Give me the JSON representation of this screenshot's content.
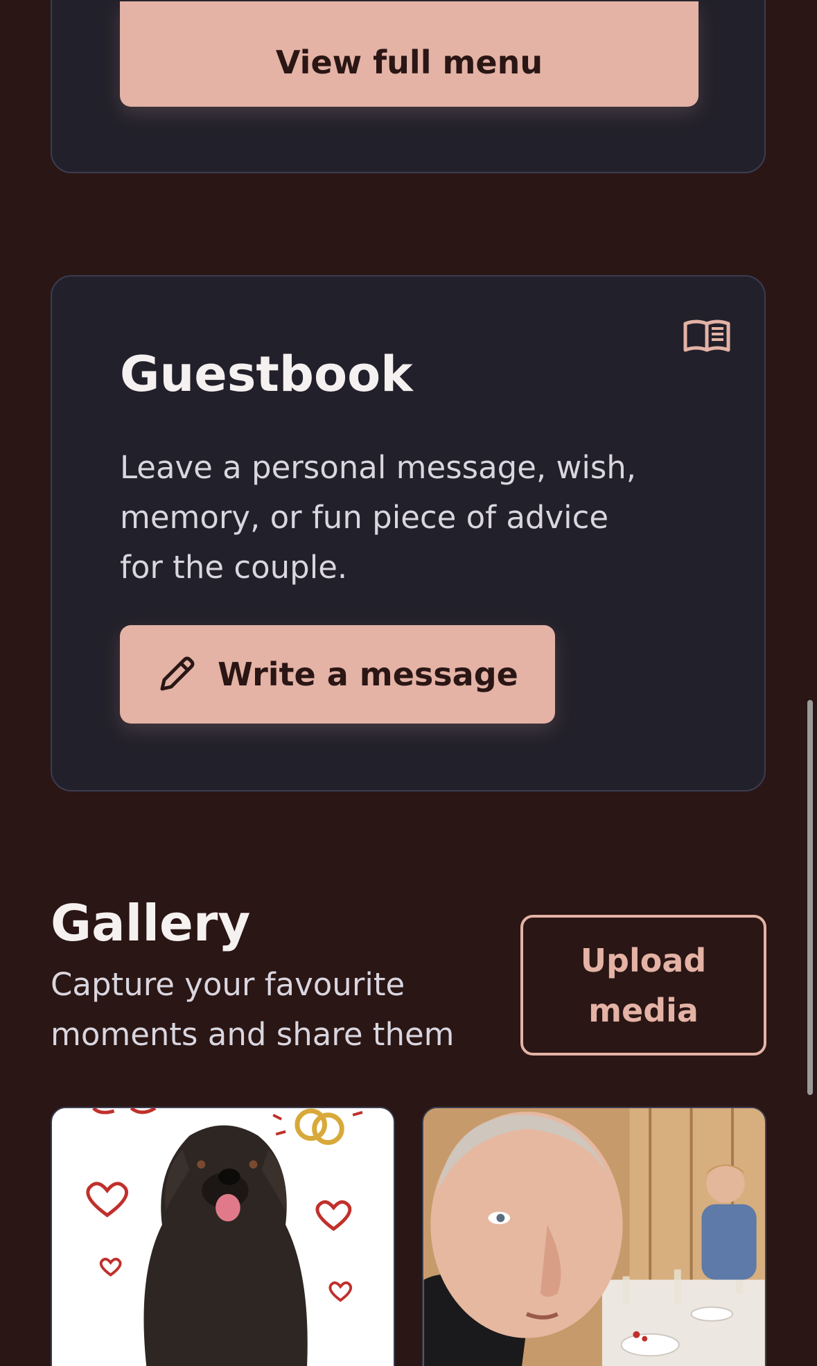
{
  "menu_card": {
    "view_menu_label": "View full menu"
  },
  "guestbook": {
    "title": "Guestbook",
    "description": "Leave a personal message, wish, memory, or fun piece of advice for the couple.",
    "write_label": "Write a message",
    "icon": "open-book-icon",
    "write_icon": "pencil-icon"
  },
  "gallery": {
    "title": "Gallery",
    "subtitle": "Capture your favourite moments and share them",
    "upload_label": "Upload media",
    "thumbnails": [
      {
        "subject": "dog-with-hearts-photo"
      },
      {
        "subject": "guests-at-dinner-photo"
      }
    ]
  },
  "colors": {
    "background": "#2a1614",
    "card": "#22202a",
    "card_border": "#3b3d52",
    "accent": "#e4b3a6",
    "text_primary": "#f6f1f1",
    "text_secondary": "#d9d6e0"
  }
}
